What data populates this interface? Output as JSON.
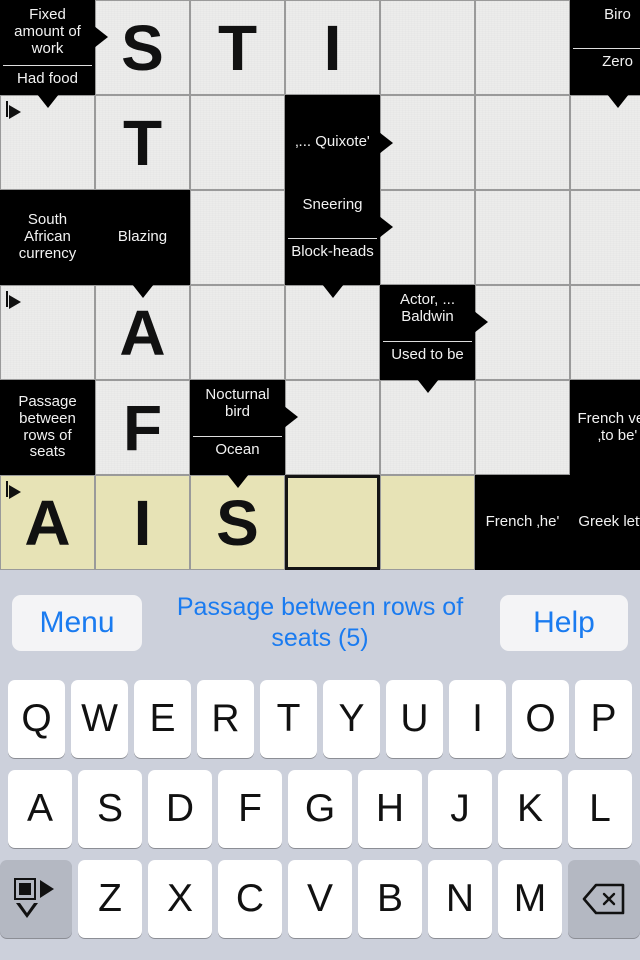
{
  "app": {
    "grid": {
      "rows": 6,
      "cols": 7,
      "cell_size": 95
    },
    "cells": [
      {
        "r": 0,
        "c": 0,
        "type": "clue",
        "clues": [
          "Fixed amount of work",
          "Had food"
        ],
        "arrows": [
          "right-top",
          "down-bottom"
        ]
      },
      {
        "r": 0,
        "c": 1,
        "type": "open",
        "letter": "S"
      },
      {
        "r": 0,
        "c": 2,
        "type": "open",
        "letter": "T"
      },
      {
        "r": 0,
        "c": 3,
        "type": "open",
        "letter": "I"
      },
      {
        "r": 0,
        "c": 4,
        "type": "open",
        "letter": ""
      },
      {
        "r": 0,
        "c": 5,
        "type": "open",
        "letter": ""
      },
      {
        "r": 0,
        "c": 6,
        "type": "clue",
        "clues": [
          "Biro",
          "Zero"
        ],
        "arrows": [
          "down-bottom"
        ]
      },
      {
        "r": 1,
        "c": 0,
        "type": "open",
        "letter": "",
        "start": true
      },
      {
        "r": 1,
        "c": 1,
        "type": "open",
        "letter": "T"
      },
      {
        "r": 1,
        "c": 2,
        "type": "open",
        "letter": ""
      },
      {
        "r": 1,
        "c": 3,
        "type": "clue",
        "clues": [
          "‚... Quixote'"
        ],
        "arrows": [
          "right-mid"
        ]
      },
      {
        "r": 1,
        "c": 4,
        "type": "open",
        "letter": ""
      },
      {
        "r": 1,
        "c": 5,
        "type": "open",
        "letter": ""
      },
      {
        "r": 1,
        "c": 6,
        "type": "open",
        "letter": ""
      },
      {
        "r": 2,
        "c": 0,
        "type": "clue",
        "clues": [
          "South African currency"
        ],
        "arrows": []
      },
      {
        "r": 2,
        "c": 1,
        "type": "clue",
        "clues": [
          "Blazing"
        ],
        "arrows": [
          "down-bottom"
        ]
      },
      {
        "r": 2,
        "c": 2,
        "type": "open",
        "letter": ""
      },
      {
        "r": 2,
        "c": 3,
        "type": "clue",
        "clues": [
          "Sneering",
          "Block-heads"
        ],
        "arrows": [
          "right-top",
          "down-bottom"
        ]
      },
      {
        "r": 2,
        "c": 4,
        "type": "open",
        "letter": ""
      },
      {
        "r": 2,
        "c": 5,
        "type": "open",
        "letter": ""
      },
      {
        "r": 2,
        "c": 6,
        "type": "open",
        "letter": ""
      },
      {
        "r": 3,
        "c": 0,
        "type": "open",
        "letter": "",
        "start": true
      },
      {
        "r": 3,
        "c": 1,
        "type": "open",
        "letter": "A"
      },
      {
        "r": 3,
        "c": 2,
        "type": "open",
        "letter": ""
      },
      {
        "r": 3,
        "c": 3,
        "type": "open",
        "letter": ""
      },
      {
        "r": 3,
        "c": 4,
        "type": "clue",
        "clues": [
          "Actor, ... Baldwin",
          "Used to be"
        ],
        "arrows": [
          "right-top",
          "down-bottom"
        ]
      },
      {
        "r": 3,
        "c": 5,
        "type": "open",
        "letter": ""
      },
      {
        "r": 3,
        "c": 6,
        "type": "open",
        "letter": ""
      },
      {
        "r": 4,
        "c": 0,
        "type": "clue",
        "clues": [
          "Passage between rows of seats"
        ],
        "arrows": []
      },
      {
        "r": 4,
        "c": 1,
        "type": "open",
        "letter": "F"
      },
      {
        "r": 4,
        "c": 2,
        "type": "clue",
        "clues": [
          "Nocturnal bird",
          "Ocean"
        ],
        "arrows": [
          "right-top",
          "down-bottom"
        ]
      },
      {
        "r": 4,
        "c": 3,
        "type": "open",
        "letter": ""
      },
      {
        "r": 4,
        "c": 4,
        "type": "open",
        "letter": ""
      },
      {
        "r": 4,
        "c": 5,
        "type": "open",
        "letter": ""
      },
      {
        "r": 4,
        "c": 6,
        "type": "clue",
        "clues": [
          "French verb ‚to be'"
        ],
        "arrows": []
      },
      {
        "r": 5,
        "c": 0,
        "type": "open",
        "letter": "A",
        "highlight": true,
        "start": true
      },
      {
        "r": 5,
        "c": 1,
        "type": "open",
        "letter": "I",
        "highlight": true
      },
      {
        "r": 5,
        "c": 2,
        "type": "open",
        "letter": "S",
        "highlight": true
      },
      {
        "r": 5,
        "c": 3,
        "type": "open",
        "letter": "",
        "highlight": true,
        "cursor": true
      },
      {
        "r": 5,
        "c": 4,
        "type": "open",
        "letter": "",
        "highlight": true
      },
      {
        "r": 5,
        "c": 5,
        "type": "clue",
        "clues": [
          "French ‚he'"
        ],
        "arrows": []
      },
      {
        "r": 5,
        "c": 6,
        "type": "clue",
        "clues": [
          "Greek letter"
        ],
        "arrows": []
      }
    ],
    "toolbar": {
      "menu_label": "Menu",
      "help_label": "Help",
      "current_clue": "Passage between rows of seats (5)",
      "accent_color": "#1a7bf0"
    },
    "keyboard": {
      "row1": [
        "Q",
        "W",
        "E",
        "R",
        "T",
        "Y",
        "U",
        "I",
        "O",
        "P"
      ],
      "row2": [
        "A",
        "S",
        "D",
        "F",
        "G",
        "H",
        "J",
        "K",
        "L"
      ],
      "row3": [
        "Z",
        "X",
        "C",
        "V",
        "B",
        "N",
        "M"
      ],
      "direction_key_icon": "direction-toggle-icon",
      "backspace_key_icon": "backspace-icon"
    },
    "colors": {
      "grid_open": "#ececeb",
      "grid_clue": "#000000",
      "highlight": "#e7e3b6",
      "chrome": "#ccd0db",
      "key_face": "#ffffff",
      "key_fn": "#b4b8c2"
    }
  }
}
